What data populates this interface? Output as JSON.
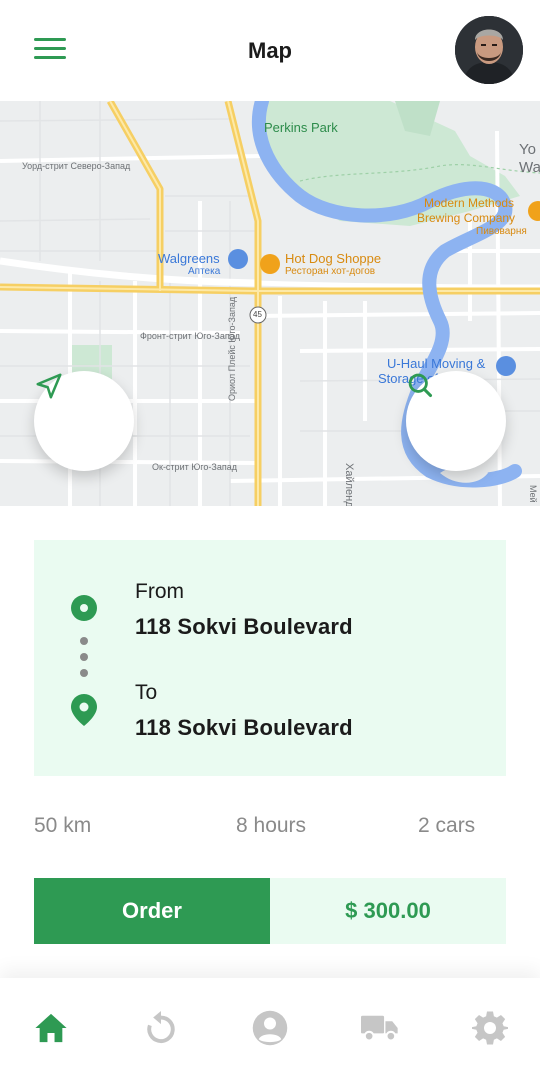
{
  "header": {
    "title": "Map"
  },
  "map": {
    "places": {
      "perkins_park": "Perkins Park",
      "street_northwest": "Уорд-стрит Северо-Запад",
      "walgreens": "Walgreens",
      "walgreens_sub": "Аптека",
      "hot_dog": "Hot Dog Shoppe",
      "hot_dog_sub": "Ресторан хот-догов",
      "modern_methods": "Modern Methods",
      "brewing": "Brewing Company",
      "brewing_sub": "Пивоварня",
      "front_street": "Фронт-стрит Юго-Запад",
      "route_45": "45",
      "uhaul": "U-Haul Moving &",
      "uhaul2": "Storage of Union",
      "orion_place": "Ориол Плейс Юго-Запад",
      "ok_street": "Ок-стрит Юго-Запад",
      "highland": "Хайленд",
      "edge_wa": "Wa",
      "edge_yo": "Yo",
      "edge_me": "Мей"
    }
  },
  "route": {
    "from_label": "From",
    "from_address": "118 Sokvi Boulevard",
    "to_label": "To",
    "to_address": "118 Sokvi Boulevard"
  },
  "stats": {
    "distance": "50 km",
    "duration": "8 hours",
    "cars": "2 cars"
  },
  "order": {
    "button_label": "Order",
    "price": "$ 300.00"
  },
  "colors": {
    "accent": "#2e9a53",
    "card_bg": "#eafbf1",
    "muted_text": "#8a8a8a"
  },
  "nav": {
    "items": [
      "home-icon",
      "history-icon",
      "profile-icon",
      "truck-icon",
      "settings-icon"
    ],
    "active": "home-icon"
  }
}
